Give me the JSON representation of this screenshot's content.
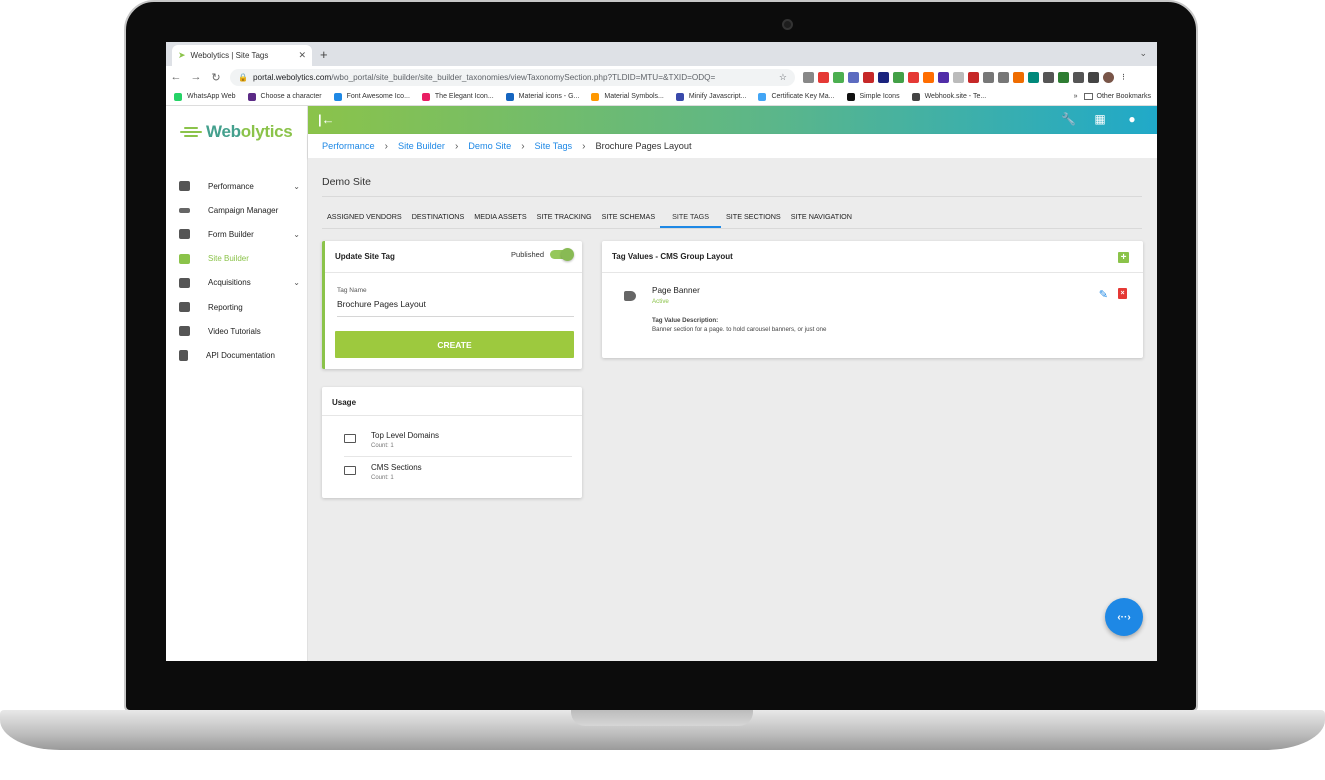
{
  "browser": {
    "tab_title": "Webolytics | Site Tags",
    "tab_close": "✕",
    "new_tab": "+",
    "tab_menu": "⌄",
    "url_host": "portal.webolytics.com",
    "url_path": "/wbo_portal/site_builder/site_builder_taxonomies/viewTaxonomySection.php?TLDID=MTU=&TXID=ODQ=",
    "bookmarks": [
      {
        "label": "WhatsApp Web",
        "color": "#25d366"
      },
      {
        "label": "Choose a character",
        "color": "#5b2a86"
      },
      {
        "label": "Font Awesome Ico...",
        "color": "#1e88e5"
      },
      {
        "label": "The Elegant Icon...",
        "color": "#e91e63"
      },
      {
        "label": "Material icons - G...",
        "color": "#1565c0"
      },
      {
        "label": "Material Symbols...",
        "color": "#ff9800"
      },
      {
        "label": "Minify Javascript...",
        "color": "#3949ab"
      },
      {
        "label": "Certificate Key Ma...",
        "color": "#42a5f5"
      },
      {
        "label": "Simple Icons",
        "color": "#111111"
      },
      {
        "label": "Webhook.site - Te...",
        "color": "#444444"
      }
    ],
    "bookmarks_more": "»",
    "other_bookmarks": "Other Bookmarks"
  },
  "app": {
    "logo_text_a": "Web",
    "logo_text_b": "olytics",
    "sidebar": [
      {
        "label": "Performance",
        "chevron": "⌄"
      },
      {
        "label": "Campaign Manager",
        "chevron": ""
      },
      {
        "label": "Form Builder",
        "chevron": "⌄"
      },
      {
        "label": "Site Builder",
        "chevron": ""
      },
      {
        "label": "Acquisitions",
        "chevron": "⌄"
      },
      {
        "label": "Reporting",
        "chevron": ""
      },
      {
        "label": "Video Tutorials",
        "chevron": ""
      },
      {
        "label": "API Documentation",
        "chevron": ""
      }
    ],
    "breadcrumbs": [
      "Performance",
      "Site Builder",
      "Demo Site",
      "Site Tags",
      "Brochure Pages Layout"
    ],
    "page_title": "Demo Site",
    "tabs": [
      "ASSIGNED VENDORS",
      "DESTINATIONS",
      "MEDIA ASSETS",
      "SITE TRACKING",
      "SITE SCHEMAS",
      "SITE TAGS",
      "SITE SECTIONS",
      "SITE NAVIGATION"
    ],
    "update_card": {
      "title": "Update Site Tag",
      "published_label": "Published",
      "field_label": "Tag Name",
      "field_value": "Brochure Pages Layout",
      "create_label": "CREATE"
    },
    "usage_card": {
      "title": "Usage",
      "rows": [
        {
          "name": "Top Level Domains",
          "count": "Count: 1"
        },
        {
          "name": "CMS Sections",
          "count": "Count: 1"
        }
      ]
    },
    "values_card": {
      "title": "Tag Values - CMS Group Layout",
      "add_icon": "+",
      "item_name": "Page Banner",
      "item_status": "Active",
      "desc_label": "Tag Value Description:",
      "desc_text": "Banner section for a page.  to hold carousel banners, or just one"
    },
    "fab_label": "‹··›"
  },
  "colors": {
    "accent_green": "#8bc34a",
    "accent_blue": "#1e88e5",
    "danger": "#e53935"
  }
}
